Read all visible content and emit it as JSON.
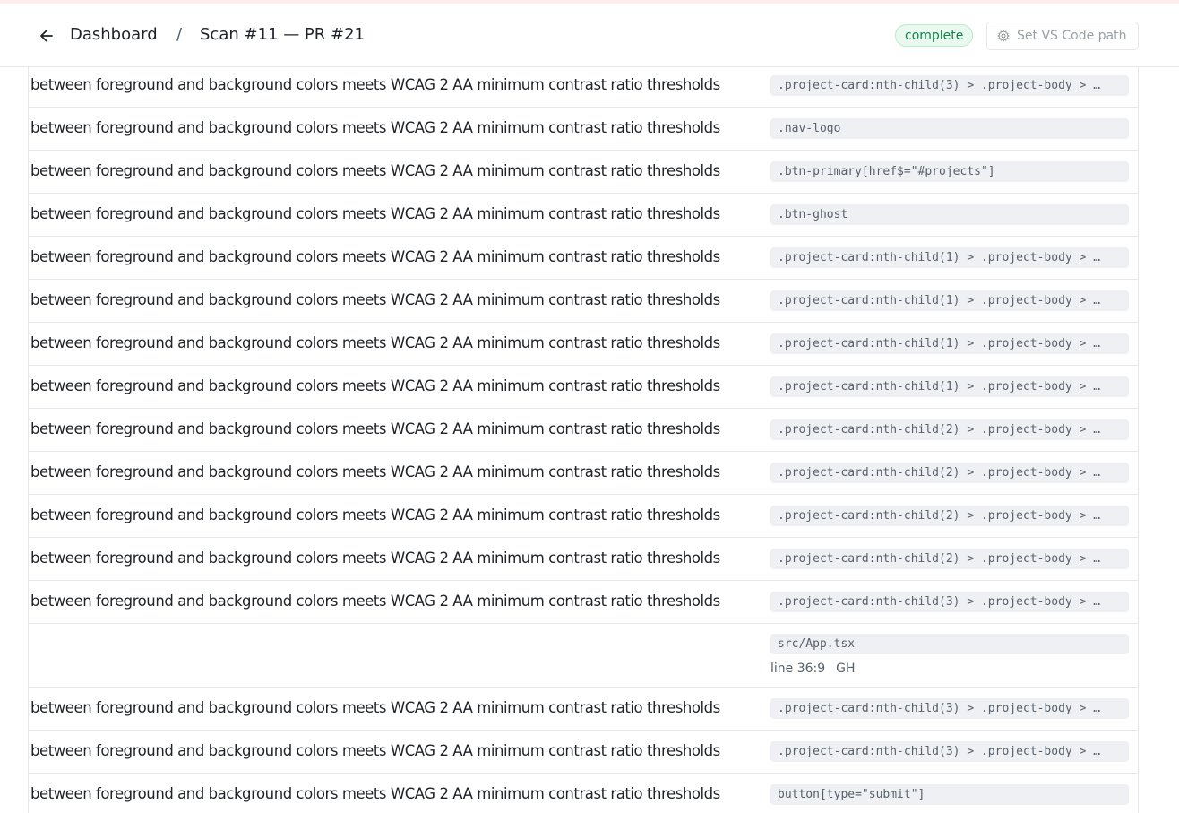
{
  "header": {
    "breadcrumb_root": "Dashboard",
    "separator": "/",
    "title": "Scan #11 — PR #21",
    "status": "complete",
    "vscode_button": "Set VS Code path"
  },
  "icons": {
    "back": "arrow-left-icon",
    "settings": "gear-icon"
  },
  "colors": {
    "status_bg": "#e9f9ef",
    "status_text": "#11804a",
    "selector_bg": "#eef0f3",
    "top_accent": "#fdeeee"
  },
  "rows": [
    {
      "desc": "between foreground and background colors meets WCAG 2 AA minimum contrast ratio thresholds",
      "selector": ".project-card:nth-child(3) > .project-body > …"
    },
    {
      "desc": "between foreground and background colors meets WCAG 2 AA minimum contrast ratio thresholds",
      "selector": ".nav-logo"
    },
    {
      "desc": "between foreground and background colors meets WCAG 2 AA minimum contrast ratio thresholds",
      "selector": ".btn-primary[href$=\"#projects\"]"
    },
    {
      "desc": "between foreground and background colors meets WCAG 2 AA minimum contrast ratio thresholds",
      "selector": ".btn-ghost"
    },
    {
      "desc": "between foreground and background colors meets WCAG 2 AA minimum contrast ratio thresholds",
      "selector": ".project-card:nth-child(1) > .project-body > …"
    },
    {
      "desc": "between foreground and background colors meets WCAG 2 AA minimum contrast ratio thresholds",
      "selector": ".project-card:nth-child(1) > .project-body > …"
    },
    {
      "desc": "between foreground and background colors meets WCAG 2 AA minimum contrast ratio thresholds",
      "selector": ".project-card:nth-child(1) > .project-body > …"
    },
    {
      "desc": "between foreground and background colors meets WCAG 2 AA minimum contrast ratio thresholds",
      "selector": ".project-card:nth-child(1) > .project-body > …"
    },
    {
      "desc": "between foreground and background colors meets WCAG 2 AA minimum contrast ratio thresholds",
      "selector": ".project-card:nth-child(2) > .project-body > …"
    },
    {
      "desc": "between foreground and background colors meets WCAG 2 AA minimum contrast ratio thresholds",
      "selector": ".project-card:nth-child(2) > .project-body > …"
    },
    {
      "desc": "between foreground and background colors meets WCAG 2 AA minimum contrast ratio thresholds",
      "selector": ".project-card:nth-child(2) > .project-body > …"
    },
    {
      "desc": "between foreground and background colors meets WCAG 2 AA minimum contrast ratio thresholds",
      "selector": ".project-card:nth-child(2) > .project-body > …"
    },
    {
      "desc": "between foreground and background colors meets WCAG 2 AA minimum contrast ratio thresholds",
      "selector": ".project-card:nth-child(3) > .project-body > …"
    }
  ],
  "file_row": {
    "file": "src/App.tsx",
    "line": "line 36:9",
    "gh": "GH"
  },
  "rows_after": [
    {
      "desc": "between foreground and background colors meets WCAG 2 AA minimum contrast ratio thresholds",
      "selector": ".project-card:nth-child(3) > .project-body > …"
    },
    {
      "desc": "between foreground and background colors meets WCAG 2 AA minimum contrast ratio thresholds",
      "selector": ".project-card:nth-child(3) > .project-body > …"
    },
    {
      "desc": "between foreground and background colors meets WCAG 2 AA minimum contrast ratio thresholds",
      "selector": "button[type=\"submit\"]"
    }
  ]
}
